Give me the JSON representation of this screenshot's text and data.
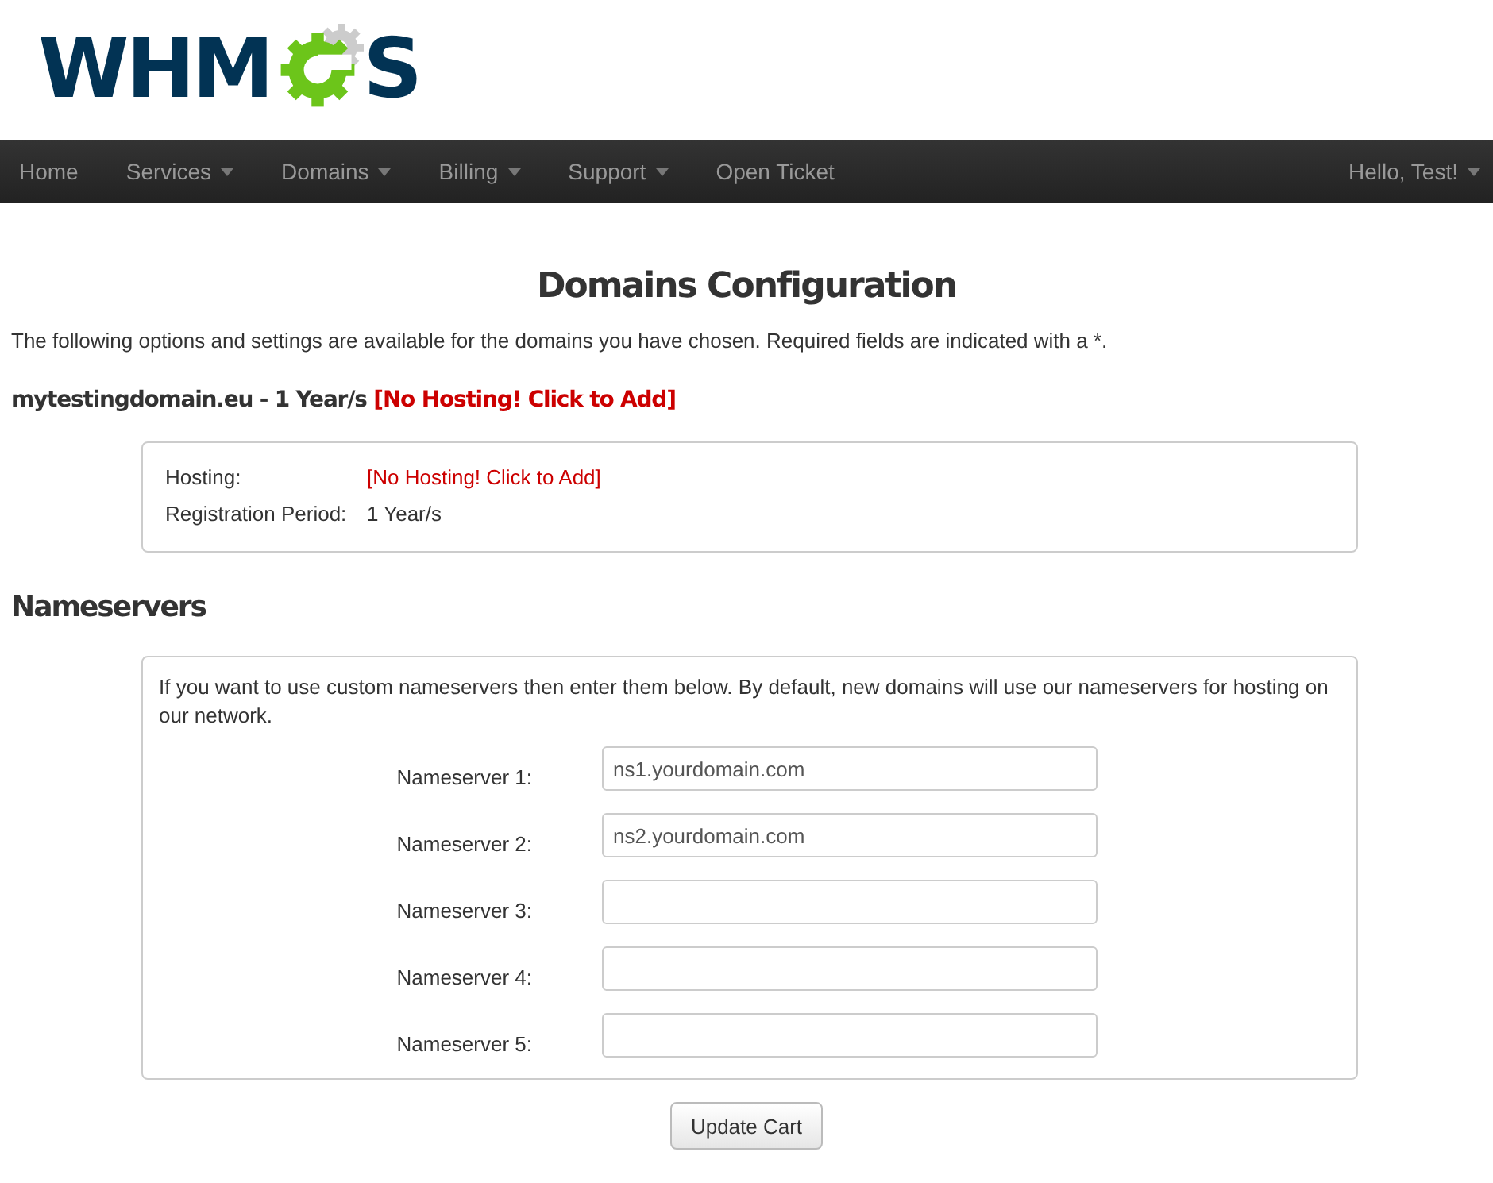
{
  "logo": {
    "left": "WHM",
    "right": "S"
  },
  "nav": {
    "items": [
      {
        "label": "Home",
        "dropdown": false
      },
      {
        "label": "Services",
        "dropdown": true
      },
      {
        "label": "Domains",
        "dropdown": true
      },
      {
        "label": "Billing",
        "dropdown": true
      },
      {
        "label": "Support",
        "dropdown": true
      },
      {
        "label": "Open Ticket",
        "dropdown": false
      }
    ],
    "user": {
      "label": "Hello, Test!",
      "dropdown": true
    }
  },
  "title": "Domains Configuration",
  "intro": "The following options and settings are available for the domains you have chosen. Required fields are indicated with a *.",
  "domain": {
    "heading": "mytestingdomain.eu - 1 Year/s",
    "link": "[No Hosting! Click to Add]",
    "details": [
      {
        "label": "Hosting:",
        "value": "[No Hosting! Click to Add]",
        "kind": "link"
      },
      {
        "label": "Registration Period:",
        "value": "1 Year/s",
        "kind": "text"
      }
    ]
  },
  "nameservers": {
    "heading": "Nameservers",
    "note": "If you want to use custom nameservers then enter them below. By default, new domains will use our nameservers for hosting on our network.",
    "fields": [
      {
        "label": "Nameserver 1:",
        "value": "ns1.yourdomain.com"
      },
      {
        "label": "Nameserver 2:",
        "value": "ns2.yourdomain.com"
      },
      {
        "label": "Nameserver 3:"
      },
      {
        "label": "Nameserver 4:"
      },
      {
        "label": "Nameserver 5:"
      }
    ]
  },
  "button": "Update Cart"
}
